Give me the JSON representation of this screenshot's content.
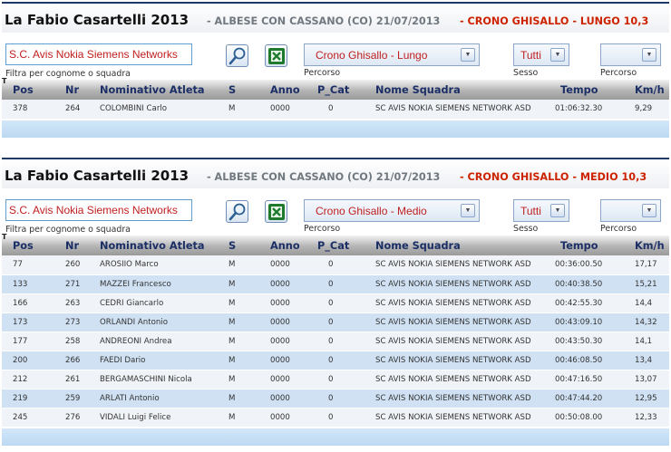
{
  "section1": {
    "title_main": "La Fabio Casartelli 2013",
    "title_location": "- ALBESE CON CASSANO (CO) 21/07/2013",
    "title_race": "- CRONO GHISALLO - LUNGO 10,3",
    "filter_value": "S.C. Avis Nokia Siemens Networks",
    "filter_caption": "Filtra per cognome o squadra",
    "percorso_selected": "Crono Ghisallo - Lungo",
    "percorso_caption": "Percorso",
    "sesso_selected": "Tutti",
    "sesso_caption": "Sesso",
    "percorso2_selected": "",
    "percorso2_caption": "Percorso",
    "rows": [
      {
        "pos": "378",
        "nr": "264",
        "atleta": "COLOMBINI Carlo",
        "s": "M",
        "anno": "0000",
        "pcat": "0",
        "squadra": "SC AVIS NOKIA SIEMENS NETWORK ASD",
        "tempo": "01:06:32.30",
        "kmh": "9,29"
      }
    ]
  },
  "section2": {
    "title_main": "La Fabio Casartelli 2013",
    "title_location": "- ALBESE CON CASSANO (CO) 21/07/2013",
    "title_race": "- CRONO GHISALLO - MEDIO 10,3",
    "filter_value": "S.C. Avis Nokia Siemens Networks",
    "filter_caption": "Filtra per cognome o squadra",
    "percorso_selected": "Crono Ghisallo - Medio",
    "percorso_caption": "Percorso",
    "sesso_selected": "Tutti",
    "sesso_caption": "Sesso",
    "percorso2_selected": "",
    "percorso2_caption": "Percorso",
    "rows": [
      {
        "pos": "77",
        "nr": "260",
        "atleta": "AROSIIO Marco",
        "s": "M",
        "anno": "0000",
        "pcat": "0",
        "squadra": "SC AVIS NOKIA SIEMENS NETWORK ASD",
        "tempo": "00:36:00.50",
        "kmh": "17,17"
      },
      {
        "pos": "133",
        "nr": "271",
        "atleta": "MAZZEI Francesco",
        "s": "M",
        "anno": "0000",
        "pcat": "0",
        "squadra": "SC AVIS NOKIA SIEMENS NETWORK ASD",
        "tempo": "00:40:38.50",
        "kmh": "15,21"
      },
      {
        "pos": "166",
        "nr": "263",
        "atleta": "CEDRI Giancarlo",
        "s": "M",
        "anno": "0000",
        "pcat": "0",
        "squadra": "SC AVIS NOKIA SIEMENS NETWORK ASD",
        "tempo": "00:42:55.30",
        "kmh": "14,4"
      },
      {
        "pos": "173",
        "nr": "273",
        "atleta": "ORLANDI Antonio",
        "s": "M",
        "anno": "0000",
        "pcat": "0",
        "squadra": "SC AVIS NOKIA SIEMENS NETWORK ASD",
        "tempo": "00:43:09.10",
        "kmh": "14,32"
      },
      {
        "pos": "177",
        "nr": "258",
        "atleta": "ANDREONI Andrea",
        "s": "M",
        "anno": "0000",
        "pcat": "0",
        "squadra": "SC AVIS NOKIA SIEMENS NETWORK ASD",
        "tempo": "00:43:50.30",
        "kmh": "14,1"
      },
      {
        "pos": "200",
        "nr": "266",
        "atleta": "FAEDI Dario",
        "s": "M",
        "anno": "0000",
        "pcat": "0",
        "squadra": "SC AVIS NOKIA SIEMENS NETWORK ASD",
        "tempo": "00:46:08.50",
        "kmh": "13,4"
      },
      {
        "pos": "212",
        "nr": "261",
        "atleta": "BERGAMASCHINI Nicola",
        "s": "M",
        "anno": "0000",
        "pcat": "0",
        "squadra": "SC AVIS NOKIA SIEMENS NETWORK ASD",
        "tempo": "00:47:16.50",
        "kmh": "13,07"
      },
      {
        "pos": "219",
        "nr": "259",
        "atleta": "ARLATI Antonio",
        "s": "M",
        "anno": "0000",
        "pcat": "0",
        "squadra": "SC AVIS NOKIA SIEMENS NETWORK ASD",
        "tempo": "00:47:44.20",
        "kmh": "12,95"
      },
      {
        "pos": "245",
        "nr": "276",
        "atleta": "VIDALI Luigi Felice",
        "s": "M",
        "anno": "0000",
        "pcat": "0",
        "squadra": "SC AVIS NOKIA SIEMENS NETWORK ASD",
        "tempo": "00:50:08.00",
        "kmh": "12,33"
      }
    ]
  },
  "columns": {
    "pos": "Pos",
    "nr": "Nr",
    "atleta": "Nominativo Atleta",
    "s": "S",
    "anno": "Anno",
    "pcat": "P_Cat",
    "squadra": "Nome Squadra",
    "tempo": "Tempo",
    "kmh": "Km/h"
  },
  "header_marker": "T",
  "icons": {
    "search": "magnifier-icon",
    "excel": "excel-export-icon",
    "dropdown": "chevron-down-icon"
  },
  "colors": {
    "accent_red": "#cc2200",
    "header_text": "#1b2f66",
    "row_alt": "#cfe1f3"
  }
}
